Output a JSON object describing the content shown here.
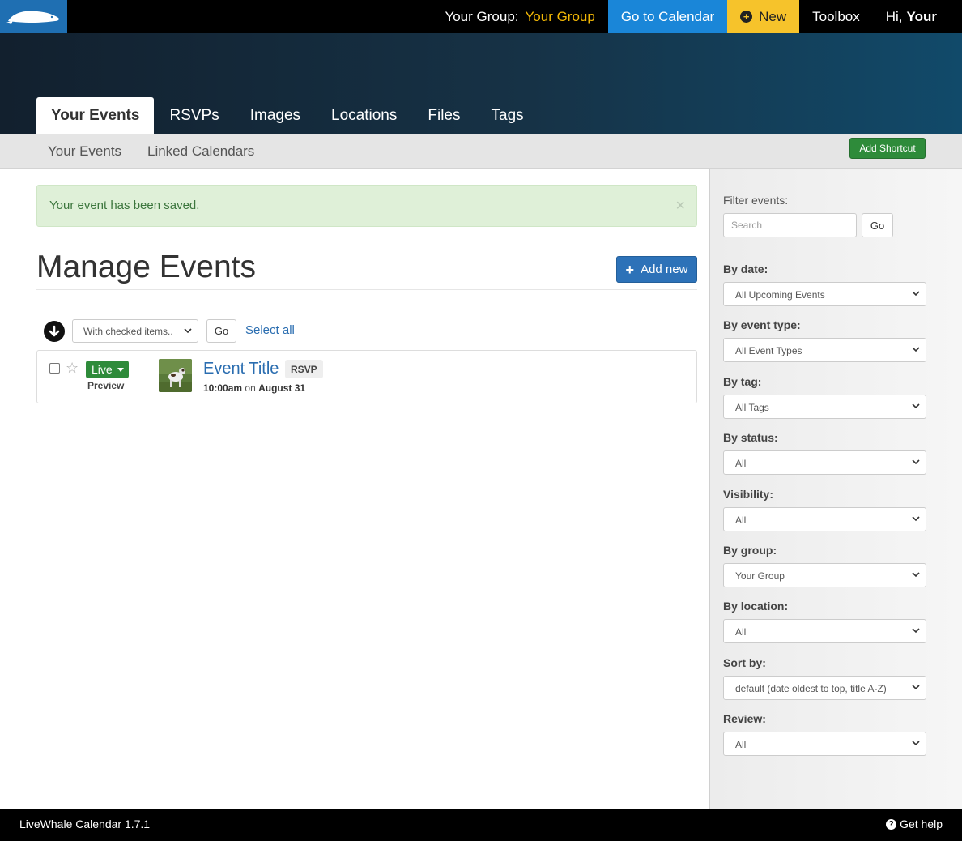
{
  "topbar": {
    "group_label": "Your Group:",
    "group_value": "Your Group",
    "calendar_link": "Go to Calendar",
    "new_label": "New",
    "toolbox_label": "Toolbox",
    "greeting": "Hi,",
    "user_name": "Your"
  },
  "tabs": [
    {
      "label": "Your Events",
      "active": true
    },
    {
      "label": "RSVPs"
    },
    {
      "label": "Images"
    },
    {
      "label": "Locations"
    },
    {
      "label": "Files"
    },
    {
      "label": "Tags"
    }
  ],
  "subnav": {
    "items": [
      "Your Events",
      "Linked Calendars"
    ],
    "shortcut_button": "Add Shortcut"
  },
  "alert": {
    "message": "Your event has been saved.",
    "close": "×"
  },
  "main": {
    "title": "Manage Events",
    "add_button": "Add new",
    "bulk_select": "With checked items..",
    "go_button": "Go",
    "select_all": "Select all"
  },
  "events": [
    {
      "status": "Live",
      "preview": "Preview",
      "title": "Event Title",
      "badge": "RSVP",
      "time": "10:00am",
      "on": "on",
      "date": "August 31"
    }
  ],
  "sidebar": {
    "filter_label": "Filter events:",
    "search_placeholder": "Search",
    "go_button": "Go",
    "filters": [
      {
        "label": "By date:",
        "value": "All Upcoming Events"
      },
      {
        "label": "By event type:",
        "value": "All Event Types"
      },
      {
        "label": "By tag:",
        "value": "All Tags"
      },
      {
        "label": "By status:",
        "value": "All"
      },
      {
        "label": "Visibility:",
        "value": "All"
      },
      {
        "label": "By group:",
        "value": "Your Group"
      },
      {
        "label": "By location:",
        "value": "All"
      },
      {
        "label": "Sort by:",
        "value": "default (date oldest to top, title A-Z)"
      },
      {
        "label": "Review:",
        "value": "All"
      }
    ]
  },
  "footer": {
    "version": "LiveWhale Calendar 1.7.1",
    "help": "Get help"
  },
  "colors": {
    "accent_blue": "#1a86d8",
    "new_yellow": "#f6c32b",
    "group_gold": "#f2b705",
    "live_green": "#2e8b3a",
    "link_blue": "#2a6db0"
  }
}
